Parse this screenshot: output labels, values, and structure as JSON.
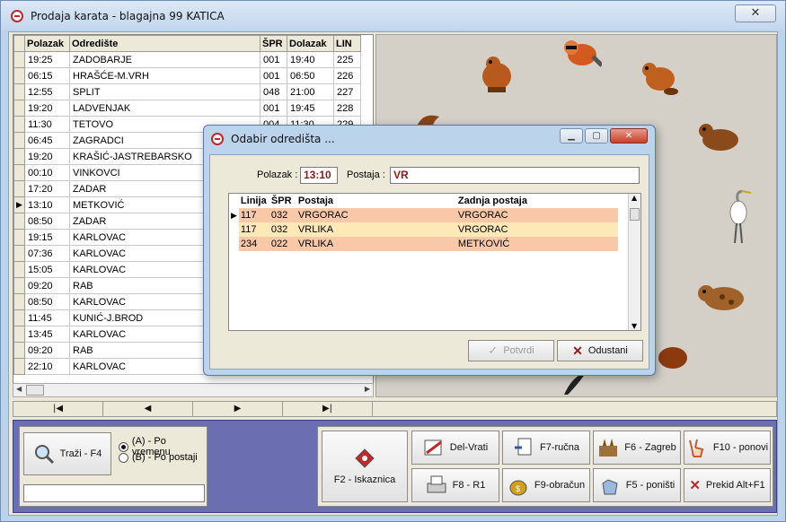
{
  "window": {
    "title": "Prodaja karata - blagajna 99 KATICA",
    "close_label": "✕"
  },
  "grid": {
    "columns": [
      "Polazak",
      "Odredište",
      "ŠPR",
      "Dolazak",
      "LIN"
    ],
    "rows": [
      {
        "polazak": "19:25",
        "odrediste": "ZADOBARJE",
        "spr": "001",
        "dolazak": "19:40",
        "lin": "225"
      },
      {
        "polazak": "06:15",
        "odrediste": "HRAŠĆE-M.VRH",
        "spr": "001",
        "dolazak": "06:50",
        "lin": "226"
      },
      {
        "polazak": "12:55",
        "odrediste": "SPLIT",
        "spr": "048",
        "dolazak": "21:00",
        "lin": "227"
      },
      {
        "polazak": "19:20",
        "odrediste": "LADVENJAK",
        "spr": "001",
        "dolazak": "19:45",
        "lin": "228"
      },
      {
        "polazak": "11:30",
        "odrediste": "TETOVO",
        "spr": "004",
        "dolazak": "11:30",
        "lin": "229"
      },
      {
        "polazak": "06:45",
        "odrediste": "ZAGRADCI",
        "spr": "",
        "dolazak": "",
        "lin": ""
      },
      {
        "polazak": "19:20",
        "odrediste": "KRAŠIĆ-JASTREBARSKO",
        "spr": "",
        "dolazak": "",
        "lin": ""
      },
      {
        "polazak": "00:10",
        "odrediste": "VINKOVCI",
        "spr": "",
        "dolazak": "",
        "lin": ""
      },
      {
        "polazak": "17:20",
        "odrediste": "ZADAR",
        "spr": "",
        "dolazak": "",
        "lin": ""
      },
      {
        "polazak": "13:10",
        "odrediste": "METKOVIĆ",
        "spr": "",
        "dolazak": "",
        "lin": ""
      },
      {
        "polazak": "08:50",
        "odrediste": "ZADAR",
        "spr": "",
        "dolazak": "",
        "lin": ""
      },
      {
        "polazak": "19:15",
        "odrediste": "KARLOVAC",
        "spr": "",
        "dolazak": "",
        "lin": ""
      },
      {
        "polazak": "07:36",
        "odrediste": "KARLOVAC",
        "spr": "",
        "dolazak": "",
        "lin": ""
      },
      {
        "polazak": "15:05",
        "odrediste": "KARLOVAC",
        "spr": "",
        "dolazak": "",
        "lin": ""
      },
      {
        "polazak": "09:20",
        "odrediste": "RAB",
        "spr": "",
        "dolazak": "",
        "lin": ""
      },
      {
        "polazak": "08:50",
        "odrediste": "KARLOVAC",
        "spr": "",
        "dolazak": "",
        "lin": ""
      },
      {
        "polazak": "11:45",
        "odrediste": "KUNIĆ-J.BROD",
        "spr": "",
        "dolazak": "",
        "lin": ""
      },
      {
        "polazak": "13:45",
        "odrediste": "KARLOVAC",
        "spr": "",
        "dolazak": "",
        "lin": ""
      },
      {
        "polazak": "09:20",
        "odrediste": "RAB",
        "spr": "",
        "dolazak": "",
        "lin": ""
      },
      {
        "polazak": "22:10",
        "odrediste": "KARLOVAC",
        "spr": "",
        "dolazak": "",
        "lin": ""
      }
    ]
  },
  "navigator": {
    "first": "|◀",
    "prev": "◀",
    "next": "▶",
    "last": "▶|"
  },
  "search": {
    "button_label": "Traži - F4",
    "radio_a": "(A) - Po vremenu",
    "radio_b": "(B) - Po postaji",
    "selected": "A",
    "input_value": ""
  },
  "actions": {
    "iskaznica": "F2 - Iskaznica",
    "del_vrati": "Del-Vrati",
    "f7": "F7-ručna",
    "f6": "F6 - Zagreb",
    "f10": "F10 - ponovi",
    "f8": "F8 - R1",
    "f9": "F9-obračun",
    "f5": "F5 - poništi",
    "prekid": "Prekid Alt+F1"
  },
  "dialog": {
    "title": "Odabir odredišta ...",
    "polazak_label": "Polazak :",
    "polazak_value": "13:10",
    "postaja_label": "Postaja :",
    "postaja_value": "VR",
    "columns": [
      "Linija",
      "ŠPR",
      "Postaja",
      "Zadnja postaja"
    ],
    "rows": [
      {
        "linija": "117",
        "spr": "032",
        "postaja": "VRGORAC",
        "zadnja": "VRGORAC"
      },
      {
        "linija": "117",
        "spr": "032",
        "postaja": "VRLIKA",
        "zadnja": "VRGORAC"
      },
      {
        "linija": "234",
        "spr": "022",
        "postaja": "VRLIKA",
        "zadnja": "METKOVIĆ"
      }
    ],
    "ok_label": "Potvrdi",
    "cancel_label": "Odustani"
  },
  "colors": {
    "row_orange": "#f9c8a8",
    "row_yellow": "#fde8b8",
    "bottom_bg": "#6b6eb0",
    "accent_red": "#c0282a"
  }
}
